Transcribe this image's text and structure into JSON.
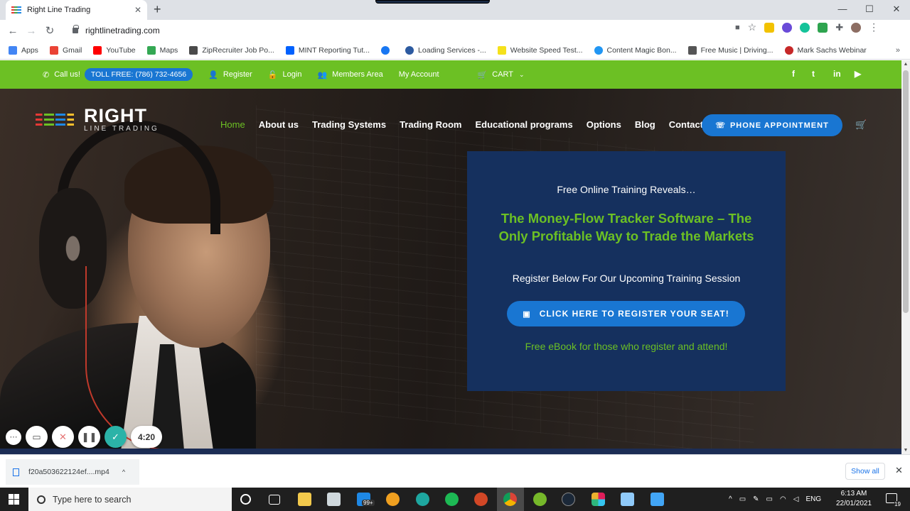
{
  "browser": {
    "tab_title": "Right Line Trading",
    "url": "rightlinetrading.com",
    "bookmarks": [
      {
        "label": "Apps",
        "color": "#4285f4"
      },
      {
        "label": "Gmail",
        "color": "#ea4335"
      },
      {
        "label": "YouTube",
        "color": "#ff0000"
      },
      {
        "label": "Maps",
        "color": "#34a853"
      },
      {
        "label": "ZipRecruiter Job Po...",
        "color": "#4a4a4a"
      },
      {
        "label": "MINT Reporting Tut...",
        "color": "#0061fe"
      },
      {
        "label": "",
        "color": "#1877f2"
      },
      {
        "label": "Loading Services -...",
        "color": "#2c5aa0"
      },
      {
        "label": "Website Speed Test...",
        "color": "#f5e11b"
      },
      {
        "label": "Content Magic Bon...",
        "color": "#2196f3"
      },
      {
        "label": "Free Music | Driving...",
        "color": "#555555"
      },
      {
        "label": "Mark Sachs Webinar",
        "color": "#c62828"
      }
    ]
  },
  "site": {
    "topbar": {
      "call_label": "Call us!",
      "toll_free": "TOLL FREE: (786) 732-4656",
      "register": "Register",
      "login": "Login",
      "members": "Members Area",
      "account": "My Account",
      "cart": "CART"
    },
    "logo": {
      "name": "RIGHT",
      "sub": "LINE TRADING"
    },
    "nav": [
      "Home",
      "About us",
      "Trading Systems",
      "Trading Room",
      "Educational programs",
      "Options",
      "Blog",
      "Contact"
    ],
    "phone_button": "PHONE APPOINTMENT",
    "card": {
      "intro": "Free Online Training Reveals…",
      "headline": "The Money-Flow Tracker Software – The Only Profitable Way to Trade the Markets",
      "subtitle": "Register Below For Our Upcoming Training Session",
      "cta": "CLICK HERE TO REGISTER YOUR SEAT!",
      "ebook": "Free eBook for those who register and attend!"
    }
  },
  "recorder": {
    "timer": "4:20"
  },
  "download": {
    "filename": "f20a503622124ef....mp4",
    "show_all": "Show all"
  },
  "taskbar": {
    "search_placeholder": "Type here to search",
    "badge": "99+",
    "lang": "ENG",
    "time": "6:13 AM",
    "date": "22/01/2021",
    "notif_count": "19"
  },
  "colors": {
    "green": "#6cc024",
    "blue": "#1976d2",
    "navy": "#15305e"
  }
}
